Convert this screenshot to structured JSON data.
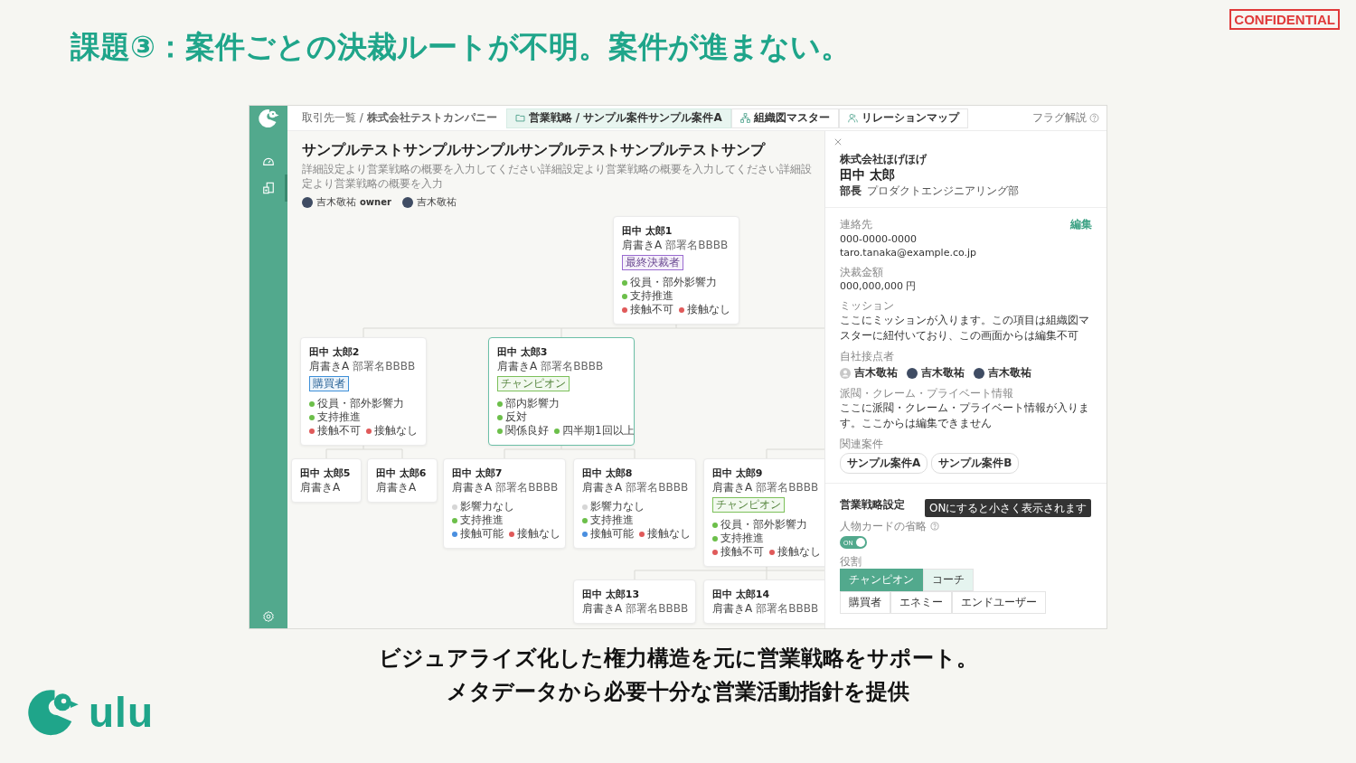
{
  "title": "課題③：案件ごとの決裁ルートが不明。案件が進まない。",
  "confidential": "CONFIDENTIAL",
  "app": {
    "sidebar": {
      "items": [
        {
          "kind": "dashboard",
          "selected": false
        },
        {
          "kind": "documents",
          "selected": true
        }
      ]
    },
    "breadcrumb": "取引先一覧 / **株式会社テストカンパニー**",
    "tabs": [
      {
        "kind": "folder",
        "label": "営業戦略 / サンプル案件サンプル案件A",
        "selected": true
      },
      {
        "kind": "org",
        "label": "組織図マスター",
        "selected": false
      },
      {
        "kind": "people",
        "label": "リレーションマップ",
        "selected": false
      }
    ],
    "help_link": "フラグ解説",
    "strategy": {
      "title": "サンプルテストサンプルサンプルサンプルテストサンプルテストサンプ",
      "description": "詳細設定より営業戦略の概要を入力してください詳細設定より営業戦略の概要を入力してください詳細設定より営業戦略の概要を入力",
      "members": [
        {
          "name": "吉木敬祐",
          "role": "owner"
        },
        {
          "name": "吉木敬祐"
        }
      ]
    },
    "org_chart": {
      "nodes": [
        {
          "name": "田中 太郎1",
          "title": "肩書きA",
          "department": "部署名BBBB",
          "tag": {
            "label": "最終決裁者",
            "color": "#9a6bd0"
          },
          "selected": false,
          "flags": [
            [
              {
                "label": "役員・部外影響力",
                "color": "#6cbf4a"
              }
            ],
            [
              {
                "label": "支持推進",
                "color": "#6cbf4a"
              }
            ],
            [
              {
                "label": "接触不可",
                "color": "#e05a5a"
              },
              {
                "label": "接触なし",
                "color": "#e05a5a"
              }
            ]
          ],
          "children": [
            {
              "name": "田中 太郎2",
              "title": "肩書きA",
              "department": "部署名BBBB",
              "tag": {
                "label": "購買者",
                "color": "#3d8fd8"
              },
              "selected": false,
              "flags": [
                [
                  {
                    "label": "役員・部外影響力",
                    "color": "#6cbf4a"
                  }
                ],
                [
                  {
                    "label": "支持推進",
                    "color": "#6cbf4a"
                  }
                ],
                [
                  {
                    "label": "接触不可",
                    "color": "#e05a5a"
                  },
                  {
                    "label": "接触なし",
                    "color": "#e05a5a"
                  }
                ]
              ],
              "children": [
                {
                  "name": "田中 太郎5",
                  "title": "肩書きA",
                  "selected": false
                },
                {
                  "name": "田中 太郎6",
                  "title": "肩書きA",
                  "selected": false
                }
              ]
            },
            {
              "name": "田中 太郎3",
              "title": "肩書きA",
              "department": "部署名BBBB",
              "tag": {
                "label": "チャンピオン",
                "color": "#7cc05a"
              },
              "selected": true,
              "flags": [
                [
                  {
                    "label": "部内影響力",
                    "color": "#6cbf4a"
                  }
                ],
                [
                  {
                    "label": "反対",
                    "color": "#6cbf4a"
                  }
                ],
                [
                  {
                    "label": "関係良好",
                    "color": "#6cbf4a"
                  },
                  {
                    "label": "四半期1回以上",
                    "color": "#6cbf4a"
                  }
                ]
              ],
              "children": [
                {
                  "name": "田中 太郎7",
                  "title": "肩書きA",
                  "department": "部署名BBBB",
                  "selected": false,
                  "flags": [
                    [
                      {
                        "label": "影響力なし",
                        "color": "#d6d6d6"
                      }
                    ],
                    [
                      {
                        "label": "支持推進",
                        "color": "#6cbf4a"
                      }
                    ],
                    [
                      {
                        "label": "接触可能",
                        "color": "#4a8fe0"
                      },
                      {
                        "label": "接触なし",
                        "color": "#e05a5a"
                      }
                    ]
                  ]
                },
                {
                  "name": "田中 太郎8",
                  "title": "肩書きA",
                  "department": "部署名BBBB",
                  "selected": false,
                  "flags": [
                    [
                      {
                        "label": "影響力なし",
                        "color": "#d6d6d6"
                      }
                    ],
                    [
                      {
                        "label": "支持推進",
                        "color": "#6cbf4a"
                      }
                    ],
                    [
                      {
                        "label": "接触可能",
                        "color": "#4a8fe0"
                      },
                      {
                        "label": "接触なし",
                        "color": "#e05a5a"
                      }
                    ]
                  ]
                }
              ]
            }
          ]
        },
        {
          "name": "田中 太郎9",
          "title": "肩書きA",
          "department": "部署名BBBB",
          "tag": {
            "label": "チャンピオン",
            "color": "#7cc05a"
          },
          "selected": false,
          "flags": [
            [
              {
                "label": "役員・部外影響力",
                "color": "#6cbf4a"
              }
            ],
            [
              {
                "label": "支持推進",
                "color": "#6cbf4a"
              }
            ],
            [
              {
                "label": "接触不可",
                "color": "#e05a5a"
              },
              {
                "label": "接触なし",
                "color": "#e05a5a"
              }
            ]
          ],
          "children": [
            {
              "name": "田中 太郎13",
              "title": "肩書きA",
              "department": "部署名BBBB",
              "selected": false
            },
            {
              "name": "田中 太郎14",
              "title": "肩書きA",
              "department": "部署名BBBB",
              "selected": false
            }
          ]
        }
      ]
    },
    "detail_panel": {
      "company": "株式会社ほげほげ",
      "name": "田中 太郎",
      "position": "部長",
      "department": "プロダクトエンジニアリング部",
      "contact": {
        "label": "連絡先",
        "edit": "編集",
        "phone": "000-0000-0000",
        "email": "taro.tanaka@example.co.jp"
      },
      "budget": {
        "label": "決裁金額",
        "value": "000,000,000 円"
      },
      "mission": {
        "label": "ミッション",
        "text": "ここにミッションが入ります。この項目は組織図マスターに紐付いており、この画面からは編集不可"
      },
      "contacts": {
        "label": "自社接点者",
        "people": [
          {
            "name": "吉木敬祐",
            "kind": "default"
          },
          {
            "name": "吉木敬祐",
            "kind": "photo"
          },
          {
            "name": "吉木敬祐",
            "kind": "photo"
          }
        ]
      },
      "private": {
        "label": "派閥・クレーム・プライベート情報",
        "text": "ここに派閥・クレーム・プライベート情報が入ります。ここからは編集できません"
      },
      "related": {
        "label": "関連案件",
        "items": [
          "サンプル案件A",
          "サンプル案件B"
        ]
      },
      "settings": {
        "heading": "営業戦略設定",
        "tooltip": "ONにすると小さく表示されます",
        "compact_label": "人物カードの省略",
        "compact": {
          "on": true,
          "text": "ON"
        },
        "role_label": "役割",
        "roles": [
          [
            {
              "label": "チャンピオン",
              "selected": true,
              "highlighted": false
            },
            {
              "label": "コーチ",
              "selected": false,
              "highlighted": true
            }
          ],
          [
            {
              "label": "購買者",
              "selected": false,
              "highlighted": false
            },
            {
              "label": "エネミー",
              "selected": false,
              "highlighted": false
            },
            {
              "label": "エンドユーザー",
              "selected": false,
              "highlighted": false
            }
          ]
        ]
      }
    }
  },
  "caption": [
    "ビジュアライズ化した権力構造を元に営業戦略をサポート。",
    "メタデータから必要十分な営業活動指針を提供"
  ],
  "logo": {
    "text": "ulu"
  }
}
